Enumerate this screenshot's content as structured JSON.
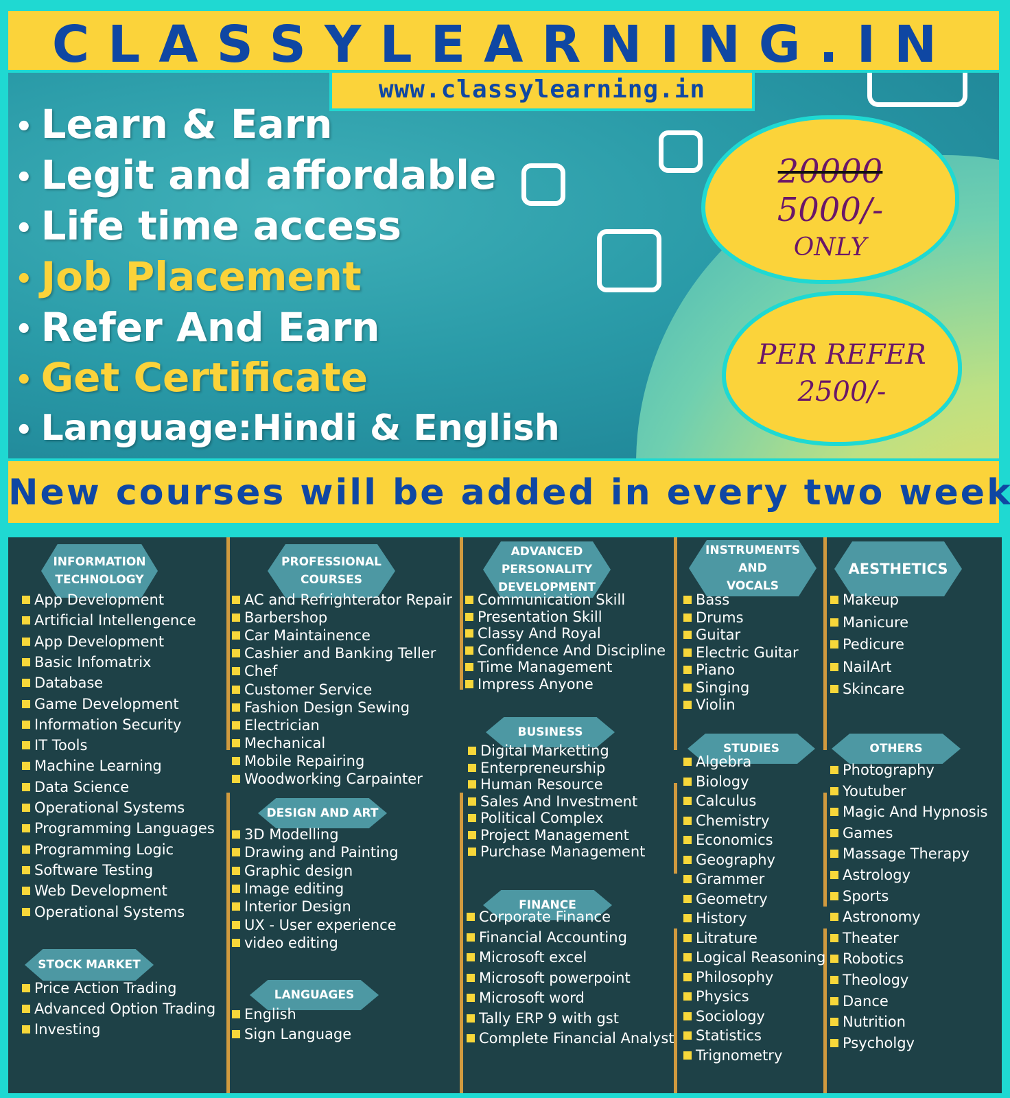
{
  "header": {
    "brand": "CLASSYLEARNING.IN",
    "url": "www.classylearning.in"
  },
  "features": [
    "Learn & Earn",
    "Legit and affordable",
    "Life time access",
    "Job Placement",
    "Refer And Earn",
    "Get Certificate",
    "Language:Hindi & English"
  ],
  "price": {
    "old": "20000",
    "new": "5000/-",
    "only": "ONLY"
  },
  "refer": {
    "line1": "PER REFER",
    "line2": "2500/-"
  },
  "announcement": "New courses will be added in every two weeks",
  "categories": {
    "it": {
      "title1": "INFORMATION",
      "title2": "TECHNOLOGY",
      "items": [
        "App Development",
        "Artificial Intellengence",
        "App Development",
        "Basic Infomatrix",
        "Database",
        "Game Development",
        "Information Security",
        "IT Tools",
        "Machine Learning",
        "Data Science",
        "Operational Systems",
        "Programming Languages",
        "Programming Logic",
        "Software Testing",
        "Web Development",
        "Operational Systems"
      ]
    },
    "stock": {
      "title": "STOCK MARKET",
      "items": [
        "Price Action Trading",
        "Advanced Option Trading",
        "Investing"
      ]
    },
    "professional": {
      "title1": "PROFESSIONAL",
      "title2": "COURSES",
      "items": [
        "AC and Refrighterator Repair",
        "Barbershop",
        "Car Maintainence",
        "Cashier and Banking Teller",
        "Chef",
        "Customer Service",
        "Fashion Design Sewing",
        "Electrician",
        "Mechanical",
        "Mobile Repairing",
        "Woodworking Carpainter"
      ]
    },
    "design": {
      "title": "DESIGN AND ART",
      "items": [
        "3D Modelling",
        "Drawing and Painting",
        "Graphic design",
        "Image editing",
        "Interior Design",
        "UX - User experience",
        "video editing"
      ]
    },
    "languages": {
      "title": "LANGUAGES",
      "items": [
        "English",
        "Sign Language"
      ]
    },
    "personality": {
      "title1": "ADVANCED",
      "title2": "PERSONALITY",
      "title3": "DEVELOPMENT",
      "items": [
        "Communication Skill",
        "Presentation Skill",
        "Classy And Royal",
        "Confidence And Discipline",
        "Time Management",
        "Impress Anyone"
      ]
    },
    "business": {
      "title": "BUSINESS",
      "items": [
        "Digital Marketting",
        "Enterpreneurship",
        "Human Resource",
        "Sales And Investment",
        "Political Complex",
        "Project Management",
        "Purchase Management"
      ]
    },
    "finance": {
      "title": "FINANCE",
      "items": [
        "Corporate Finance",
        "Financial Accounting",
        "Microsoft excel",
        "Microsoft powerpoint",
        "Microsoft word",
        "Tally ERP 9 with gst",
        "Complete Financial Analyst"
      ]
    },
    "instruments": {
      "title1": "INSTRUMENTS",
      "title2": "AND",
      "title3": "VOCALS",
      "items": [
        "Bass",
        "Drums",
        "Guitar",
        "Electric Guitar",
        "Piano",
        "Singing",
        "Violin"
      ]
    },
    "studies": {
      "title": "STUDIES",
      "items": [
        "Algebra",
        "Biology",
        "Calculus",
        "Chemistry",
        "Economics",
        "Geography",
        "Grammer",
        "Geometry",
        "History",
        "Litrature",
        "Logical Reasoning",
        "Philosophy",
        "Physics",
        "Sociology",
        "Statistics",
        "Trignometry"
      ]
    },
    "aesthetics": {
      "title": "AESTHETICS",
      "items": [
        "Makeup",
        "Manicure",
        "Pedicure",
        "NailArt",
        "Skincare"
      ]
    },
    "others": {
      "title": "OTHERS",
      "items": [
        "Photography",
        "Youtuber",
        "Magic And Hypnosis",
        "Games",
        "Massage Therapy",
        "Astrology",
        "Sports",
        "Astronomy",
        "Theater",
        "Robotics",
        "Theology",
        "Dance",
        "Nutrition",
        "Psycholgy"
      ]
    }
  },
  "colors": {
    "frame": "#1fd9d2",
    "yellow": "#fbd33a",
    "blue_text": "#0f47a3",
    "panel": "#1e4147",
    "hex": "#4d98a3",
    "bullet": "#f7d73a",
    "divider": "#d19a3f",
    "price_text": "#6a1669"
  }
}
